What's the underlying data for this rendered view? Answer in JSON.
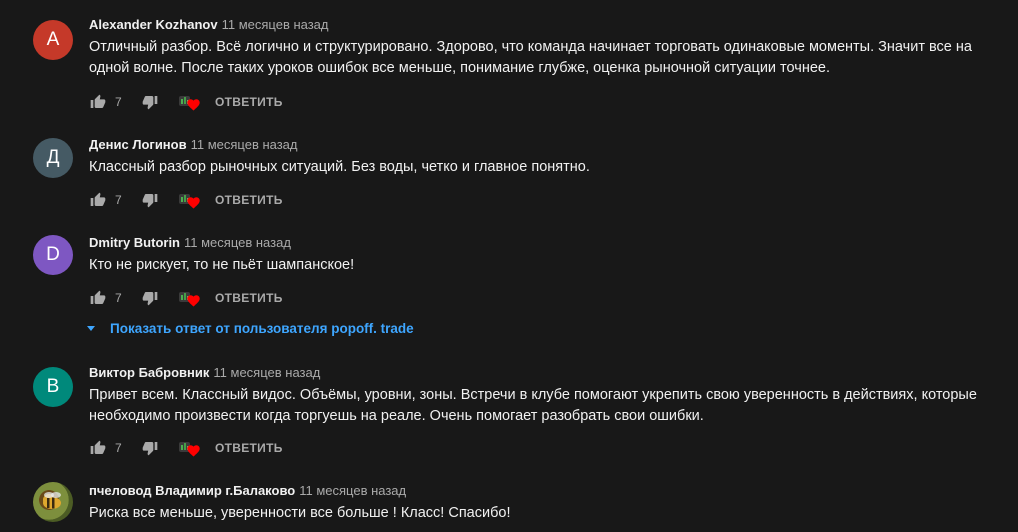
{
  "colors": {
    "background": "#181818",
    "link": "#3ea6ff",
    "heart": "#ff0000"
  },
  "comments": [
    {
      "avatar_letter": "A",
      "avatar_color": "#c53929",
      "author": "Alexander Kozhanov",
      "time": "11 месяцев назад",
      "text": "Отличный разбор. Всё логично и структурировано. Здорово, что команда начинает торговать одинаковые моменты. Значит все на одной волне. После таких уроков  ошибок все меньше, понимание глубже, оценка рыночной ситуации точнее.",
      "likes": "7",
      "reply_label": "ОТВЕТИТЬ"
    },
    {
      "avatar_letter": "Д",
      "avatar_color": "#455a64",
      "author": "Денис Логинов",
      "time": "11 месяцев назад",
      "text": "Классный разбор рыночных ситуаций. Без воды, четко и главное понятно.",
      "likes": "7",
      "reply_label": "ОТВЕТИТЬ"
    },
    {
      "avatar_letter": "D",
      "avatar_color": "#7e57c2",
      "author": "Dmitry Butorin",
      "time": "11 месяцев назад",
      "text": "Кто не рискует, то не пьёт шампанское!",
      "likes": "7",
      "reply_label": "ОТВЕТИТЬ",
      "view_replies": "Показать ответ от пользователя popoff. trade"
    },
    {
      "avatar_letter": "B",
      "avatar_color": "#00897b",
      "author": "Виктор Бабровник",
      "time": "11 месяцев назад",
      "text": "Привет  всем. Классный видос. Объёмы, уровни, зоны. Встречи в клубе помогают укрепить свою уверенность в действиях, которые необходимо произвести когда торгуешь на реале. Очень помогает разобрать свои ошибки.",
      "likes": "7",
      "reply_label": "ОТВЕТИТЬ"
    },
    {
      "avatar_letter": "",
      "avatar_color": "#6b7a3a",
      "author": "пчеловод Владимир г.Балаково",
      "time": "11 месяцев назад",
      "text": "Риска все меньше, уверенности все больше ! Класс! Спасибо!"
    }
  ]
}
